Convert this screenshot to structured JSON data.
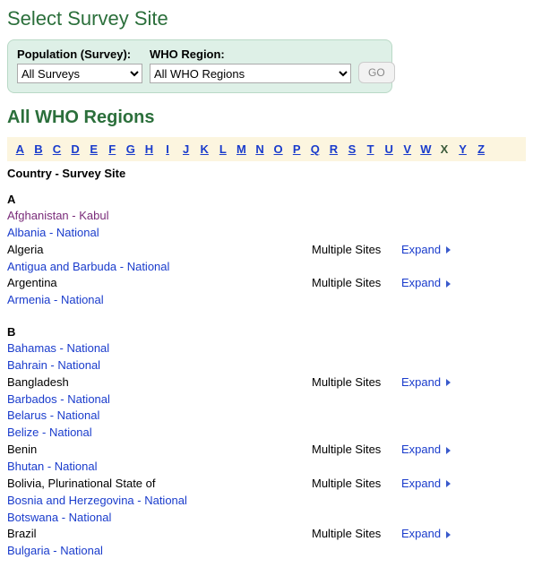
{
  "title": "Select Survey Site",
  "filters": {
    "population_label": "Population (Survey):",
    "population_value": "All Surveys",
    "region_label": "WHO Region:",
    "region_value": "All WHO Regions",
    "go_label": "GO"
  },
  "region_heading": "All WHO Regions",
  "alphabet": [
    {
      "l": "A",
      "active": true
    },
    {
      "l": "B",
      "active": true
    },
    {
      "l": "C",
      "active": true
    },
    {
      "l": "D",
      "active": true
    },
    {
      "l": "E",
      "active": true
    },
    {
      "l": "F",
      "active": true
    },
    {
      "l": "G",
      "active": true
    },
    {
      "l": "H",
      "active": true
    },
    {
      "l": "I",
      "active": true
    },
    {
      "l": "J",
      "active": true
    },
    {
      "l": "K",
      "active": true
    },
    {
      "l": "L",
      "active": true
    },
    {
      "l": "M",
      "active": true
    },
    {
      "l": "N",
      "active": true
    },
    {
      "l": "O",
      "active": true
    },
    {
      "l": "P",
      "active": true
    },
    {
      "l": "Q",
      "active": true
    },
    {
      "l": "R",
      "active": true
    },
    {
      "l": "S",
      "active": true
    },
    {
      "l": "T",
      "active": true
    },
    {
      "l": "U",
      "active": true
    },
    {
      "l": "V",
      "active": true
    },
    {
      "l": "W",
      "active": true
    },
    {
      "l": "X",
      "active": false
    },
    {
      "l": "Y",
      "active": true
    },
    {
      "l": "Z",
      "active": true
    }
  ],
  "column_header": "Country - Survey Site",
  "multi_label": "Multiple Sites",
  "expand_label": "Expand",
  "groups": [
    {
      "letter": "A",
      "rows": [
        {
          "label": "Afghanistan - Kabul",
          "type": "link",
          "visited": true
        },
        {
          "label": "Albania - National",
          "type": "link"
        },
        {
          "label": "Algeria",
          "type": "multi"
        },
        {
          "label": "Antigua and Barbuda - National",
          "type": "link"
        },
        {
          "label": "Argentina",
          "type": "multi"
        },
        {
          "label": "Armenia - National",
          "type": "link"
        }
      ]
    },
    {
      "letter": "B",
      "rows": [
        {
          "label": "Bahamas - National",
          "type": "link"
        },
        {
          "label": "Bahrain - National",
          "type": "link"
        },
        {
          "label": "Bangladesh",
          "type": "multi"
        },
        {
          "label": "Barbados - National",
          "type": "link"
        },
        {
          "label": "Belarus - National",
          "type": "link"
        },
        {
          "label": "Belize - National",
          "type": "link"
        },
        {
          "label": "Benin",
          "type": "multi"
        },
        {
          "label": "Bhutan - National",
          "type": "link"
        },
        {
          "label": "Bolivia, Plurinational State of",
          "type": "multi"
        },
        {
          "label": "Bosnia and Herzegovina - National",
          "type": "link"
        },
        {
          "label": "Botswana - National",
          "type": "link"
        },
        {
          "label": "Brazil",
          "type": "multi"
        },
        {
          "label": "Bulgaria - National",
          "type": "link"
        }
      ]
    }
  ]
}
